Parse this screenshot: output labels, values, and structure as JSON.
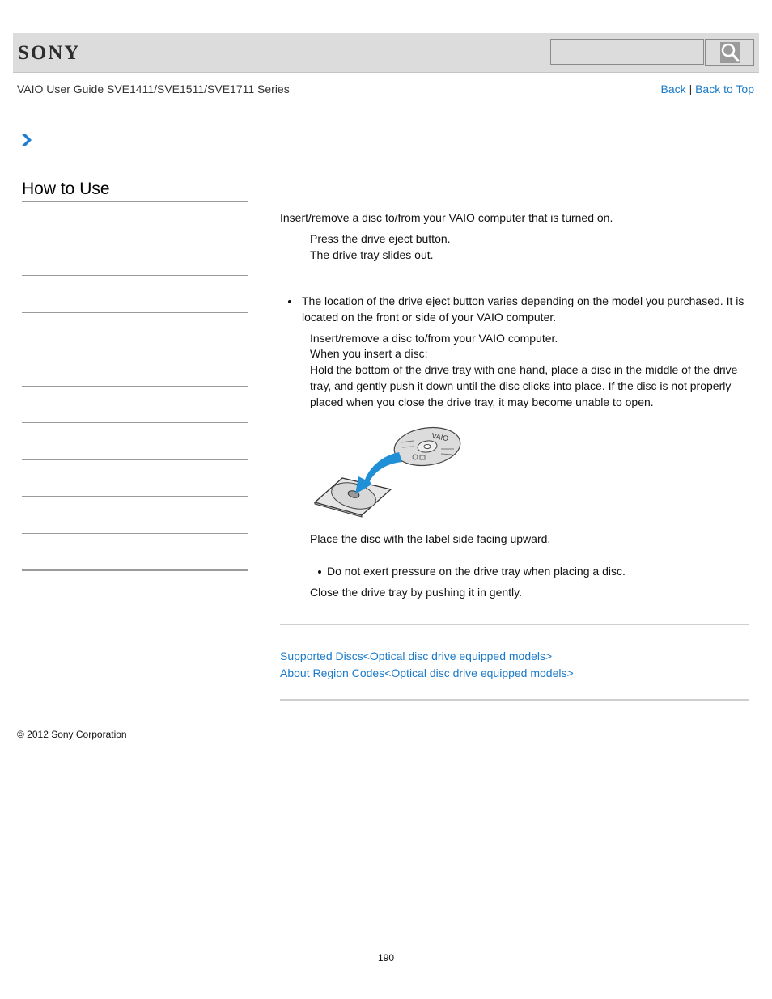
{
  "header": {
    "logo": "SONY",
    "search": {
      "value": "",
      "placeholder": ""
    },
    "search_icon": "magnifier-icon"
  },
  "subheader": {
    "title": "VAIO User Guide SVE1411/SVE1511/SVE1711 Series",
    "back_label": "Back",
    "separator": "|",
    "back_to_top_label": "Back to Top"
  },
  "breadcrumb": {
    "icon": "chevron-right-icon"
  },
  "sidebar": {
    "title": "How to Use",
    "item_count": 10
  },
  "main": {
    "intro": "Insert/remove a disc to/from your VAIO computer that is turned on.",
    "step1_line1": "Press the drive eject button.",
    "step1_line2": "The drive tray slides out.",
    "note1_line1": "The location of the drive eject button varies depending on the model you purchased. It is",
    "note1_line2": "located on the front or side of your VAIO computer.",
    "step2_line1": "Insert/remove a disc to/from your VAIO computer.",
    "step2_line2": "When you insert a disc:",
    "step2_line3": "Hold the bottom of the drive tray with one hand, place a disc in the middle of the drive",
    "step2_line4": "tray, and gently push it down until the disc clicks into place. If the disc is not properly",
    "step2_line5": "placed when you close the drive tray, it may become unable to open.",
    "illustration_label": "VAIO",
    "caption": "Place the disc with the label side facing upward.",
    "note2": "Do not exert pressure on the drive tray when placing a disc.",
    "step3": "Close the drive tray by pushing it in gently."
  },
  "related": {
    "links": [
      "Supported Discs<Optical disc drive equipped models>",
      "About Region Codes<Optical disc drive equipped models>"
    ]
  },
  "footer": {
    "copyright": "© 2012 Sony Corporation",
    "page_number": "190"
  },
  "colors": {
    "link": "#1a7ac9",
    "header_bg": "#dcdcdc",
    "arrow": "#1f8fd6"
  }
}
